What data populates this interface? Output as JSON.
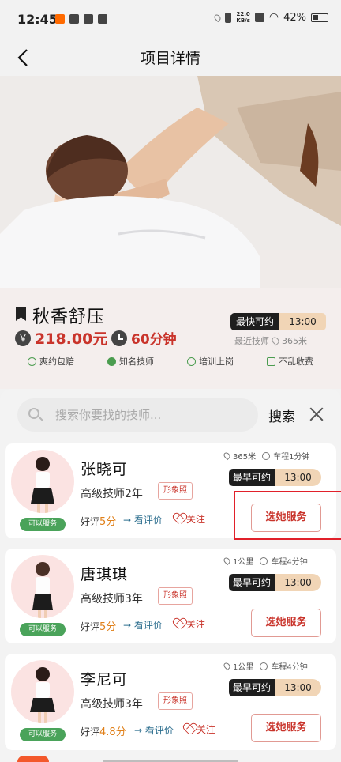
{
  "status_bar": {
    "time": "12:45",
    "net_speed_top": "22.0",
    "net_speed_unit": "KB/s",
    "battery": "42%"
  },
  "nav": {
    "title": "项目详情"
  },
  "project": {
    "name": "秋香舒压",
    "price": "218.00元",
    "duration": "60分钟",
    "fastest_label": "最快可约",
    "fastest_time": "13:00",
    "nearest_label": "最近技师",
    "nearest_distance": "365米",
    "features": [
      "爽约包赔",
      "知名技师",
      "培训上岗",
      "不乱收费"
    ]
  },
  "search": {
    "placeholder": "搜索你要找的技师...",
    "button_label": "搜索"
  },
  "technicians": [
    {
      "name": "张晓可",
      "level": "高级技师2年",
      "photo_tag": "形象照",
      "status": "可以服务",
      "rating_label": "好评",
      "rating_value": "5分",
      "reviews_label": "看评价",
      "follow_label": "关注",
      "distance": "365米",
      "drive_time": "车程1分钟",
      "earliest_label": "最早可约",
      "earliest_time": "13:00",
      "select_label": "选她服务"
    },
    {
      "name": "唐琪琪",
      "level": "高级技师3年",
      "photo_tag": "形象照",
      "status": "可以服务",
      "rating_label": "好评",
      "rating_value": "5分",
      "reviews_label": "看评价",
      "follow_label": "关注",
      "distance": "1公里",
      "drive_time": "车程4分钟",
      "earliest_label": "最早可约",
      "earliest_time": "13:00",
      "select_label": "选她服务"
    },
    {
      "name": "李尼可",
      "level": "高级技师3年",
      "photo_tag": "形象照",
      "status": "可以服务",
      "rating_label": "好评",
      "rating_value": "4.8分",
      "reviews_label": "看评价",
      "follow_label": "关注",
      "distance": "1公里",
      "drive_time": "车程4分钟",
      "earliest_label": "最早可约",
      "earliest_time": "13:00",
      "select_label": "选她服务"
    }
  ],
  "colors": {
    "accent": "#c9342b",
    "badge_green": "#4aa35a",
    "time_tag": "#f1d5b6",
    "highlight_box": "#e1202a"
  }
}
